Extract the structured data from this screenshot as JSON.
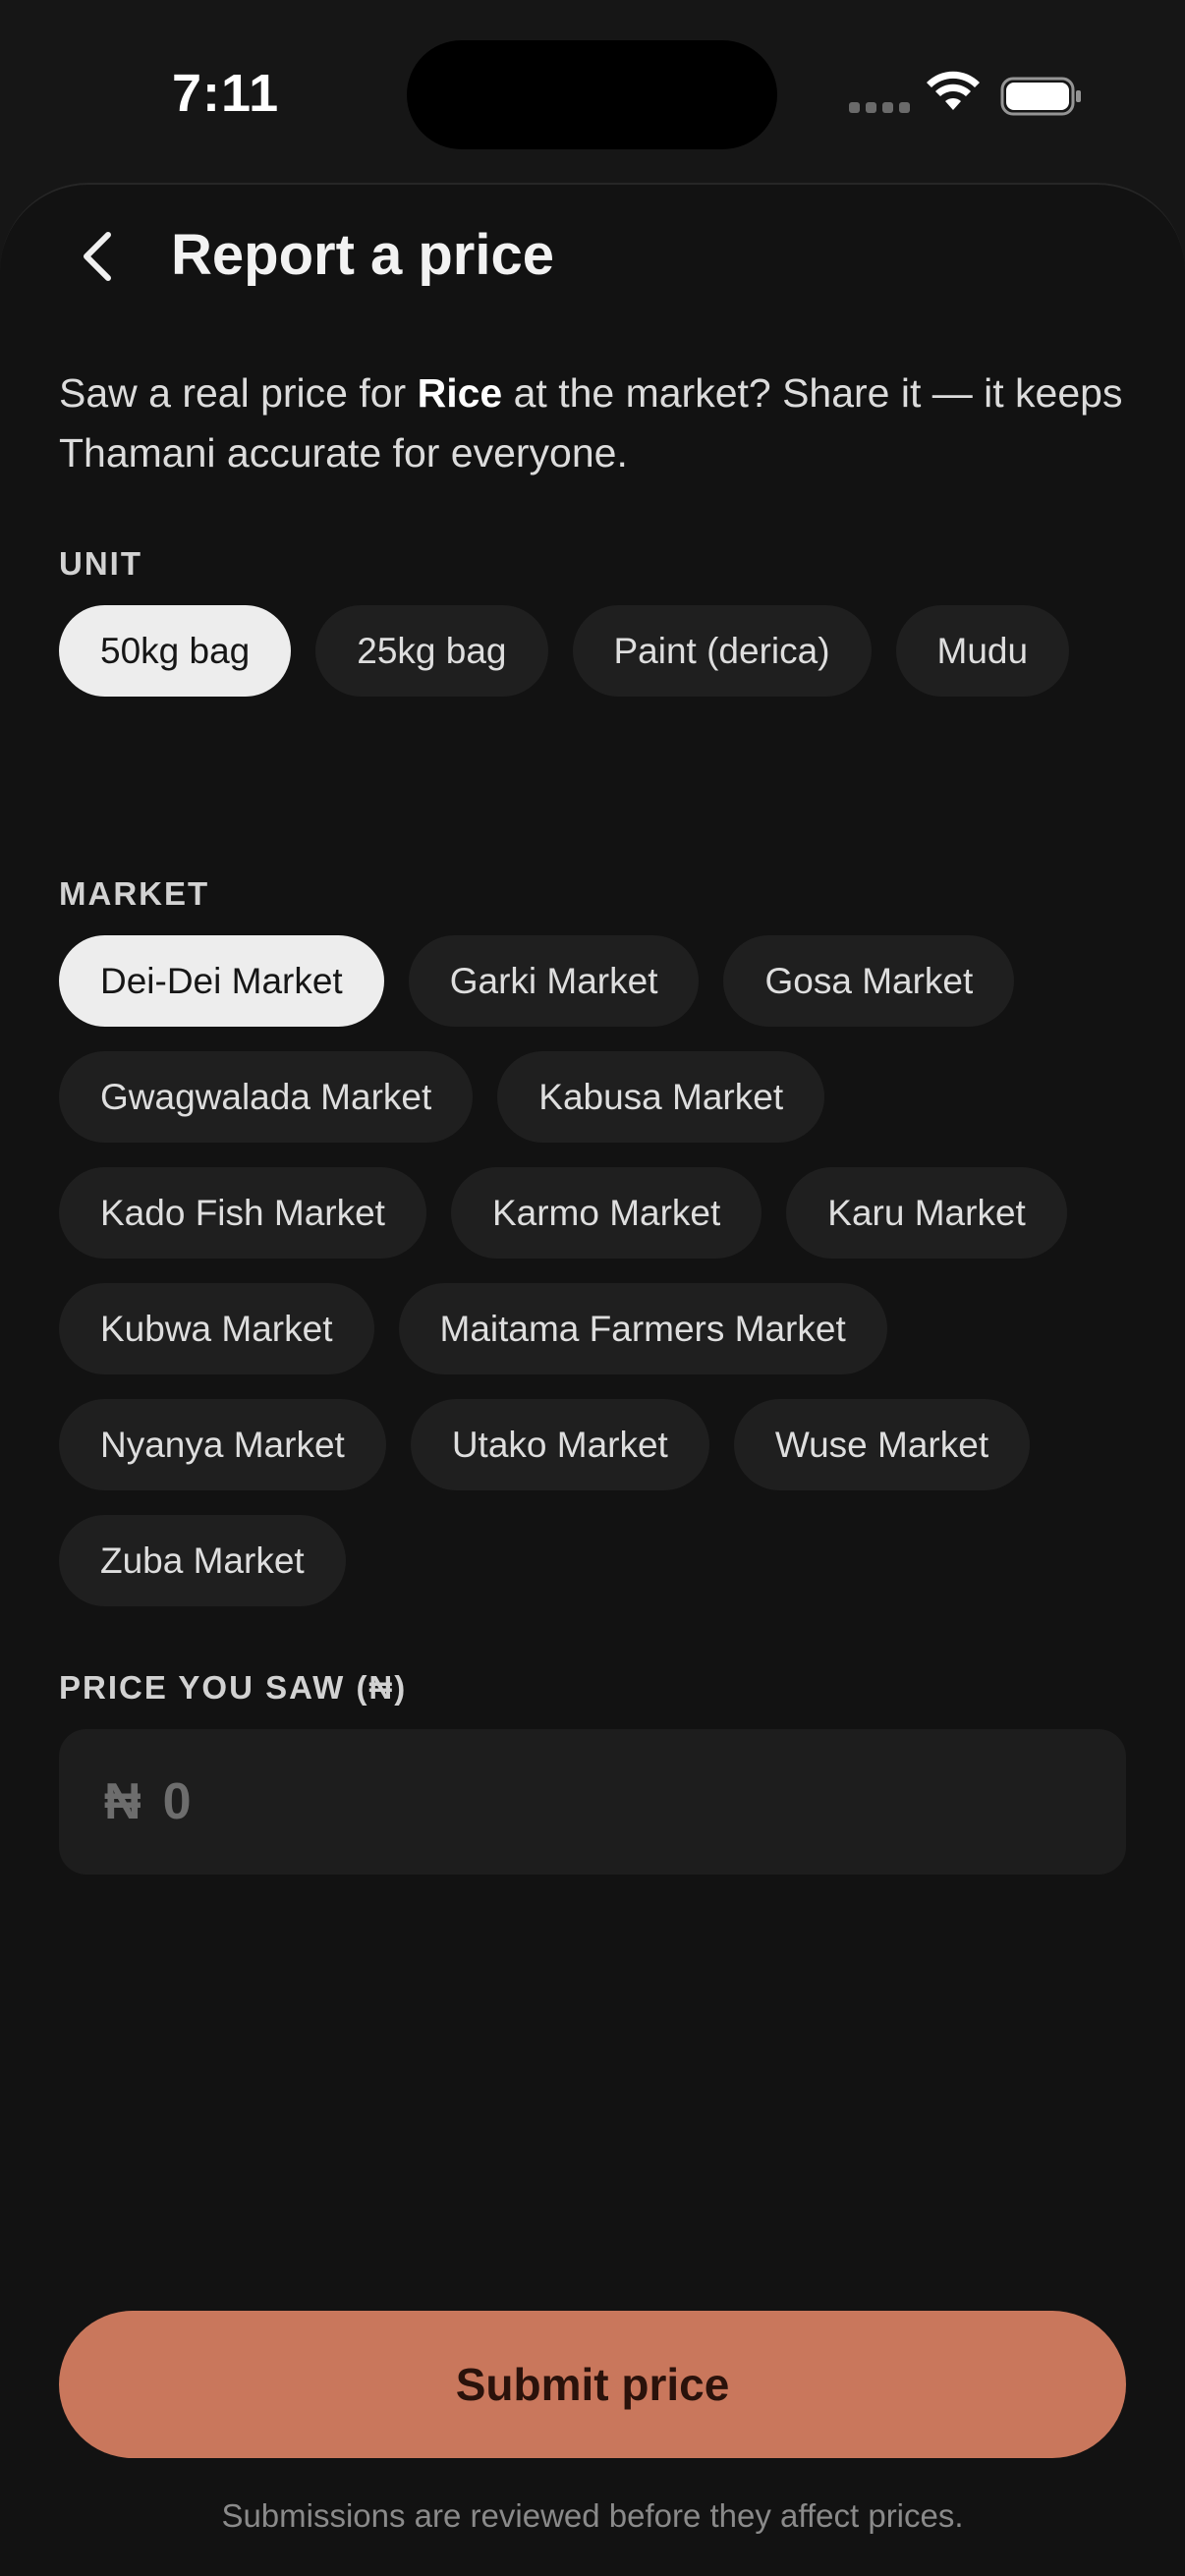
{
  "status_bar": {
    "time": "7:11"
  },
  "header": {
    "back_icon": "chevron-left-icon",
    "title": "Report a price"
  },
  "intro": {
    "prefix": "Saw a real price for ",
    "item": "Rice",
    "suffix": " at the market? Share it — it keeps Thamani accurate for everyone."
  },
  "unit": {
    "label": "UNIT",
    "selected": "50kg bag",
    "options": [
      "50kg bag",
      "25kg bag",
      "Paint (derica)",
      "Mudu"
    ]
  },
  "market": {
    "label": "MARKET",
    "selected": "Dei-Dei Market",
    "options": [
      "Dei-Dei Market",
      "Garki Market",
      "Gosa Market",
      "Gwagwalada Market",
      "Kabusa Market",
      "Kado Fish Market",
      "Karmo Market",
      "Karu Market",
      "Kubwa Market",
      "Maitama Farmers Market",
      "Nyanya Market",
      "Utako Market",
      "Wuse Market",
      "Zuba Market"
    ]
  },
  "price": {
    "label": "PRICE YOU SAW (₦)",
    "currency_symbol": "₦",
    "placeholder": "0",
    "value": ""
  },
  "submit": {
    "label": "Submit price"
  },
  "footnote": "Submissions are reviewed before they affect prices.",
  "colors": {
    "background": "#121212",
    "chip": "#1f1f1f",
    "chip_selected": "#ededed",
    "accent": "#c9775c"
  }
}
